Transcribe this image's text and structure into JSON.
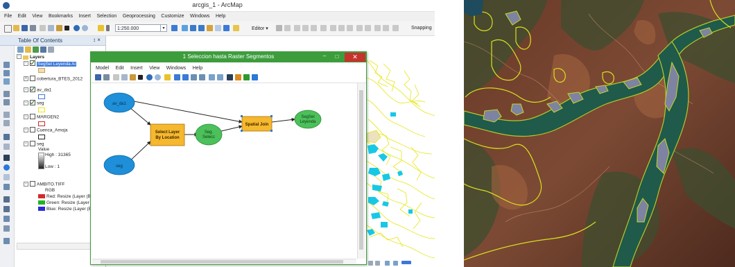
{
  "window": {
    "title": "arcgis_1 - ArcMap",
    "menu": [
      "File",
      "Edit",
      "View",
      "Bookmarks",
      "Insert",
      "Selection",
      "Geoprocessing",
      "Customize",
      "Windows",
      "Help"
    ],
    "scale": "1:250.000",
    "editor_label": "Editor ▾",
    "snapping_label": "Snapping"
  },
  "toc": {
    "title": "Table Of Contents",
    "pin": "↕ ×",
    "root": "Layers",
    "layers": [
      {
        "name": "SegSel Leyenda Ai",
        "checked": true,
        "selected": true
      },
      {
        "name": "cobertura_BTES_2012",
        "checked": false
      },
      {
        "name": "av_da1",
        "checked": true
      },
      {
        "name": "seg",
        "checked": true
      },
      {
        "name": "MARGEN2",
        "checked": false
      },
      {
        "name": "Cuenca_Amoja",
        "checked": false
      },
      {
        "name": "seg",
        "checked": false
      },
      {
        "name": "AMBITO.TIFF",
        "checked": false
      }
    ],
    "raster_legend": {
      "value_label": "Value",
      "high": "High : 31365",
      "low": "Low : 1"
    },
    "rgb_legend": {
      "title": "RGB",
      "bands": [
        {
          "label": "Red:   Resize (Layer (B",
          "color": "#d42a2a"
        },
        {
          "label": "Green: Resize (Layer (B",
          "color": "#24b324"
        },
        {
          "label": "Blue:  Resize (Layer (B",
          "color": "#2a2ad4"
        }
      ]
    }
  },
  "model": {
    "title": "1 Seleccion hasta Raster Segmentos",
    "min": "–",
    "max": "□",
    "close": "✕",
    "menu": [
      "Model",
      "Edit",
      "Insert",
      "View",
      "Windows",
      "Help"
    ],
    "inputs": [
      {
        "label": "av_da1"
      },
      {
        "label": "seg"
      }
    ],
    "tools": [
      {
        "label": "Select Layer By Location"
      },
      {
        "label": "Spatial Join"
      }
    ],
    "outputs": [
      {
        "label": "Seg. Selecc"
      },
      {
        "label": "SegSel Leyenda"
      }
    ],
    "colors": {
      "input": "#1e8fd8",
      "tool": "#f5b82e",
      "output": "#4cc05a"
    }
  },
  "colors": {
    "model_title": "#3d9d3d",
    "map_outline": "#e6e612",
    "map_fill": "#17c8e6"
  }
}
